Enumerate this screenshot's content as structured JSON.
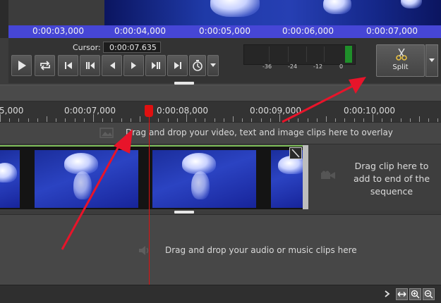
{
  "preview": {
    "ruler_ticks": [
      "0:00:03,000",
      "0:00:04,000",
      "0:00:05,000",
      "0:00:06,000",
      "0:00:07,000"
    ]
  },
  "transport": {
    "cursor_label": "Cursor:",
    "cursor_value": "0:00:07.635",
    "buttons": [
      "play",
      "loop",
      "go-to-start",
      "previous-frame-group",
      "previous-frame",
      "next-frame",
      "next-frame-group",
      "go-to-end",
      "speed"
    ]
  },
  "meter": {
    "labels": [
      "-36",
      "-24",
      "-12",
      "0"
    ]
  },
  "split": {
    "label": "Split"
  },
  "timeline": {
    "ruler_labels": [
      "5,000",
      "0:00:07,000",
      "0:00:08,000",
      "0:00:09,000",
      "0:00:10,000"
    ],
    "overlay_hint": "Drag and drop your video, text and image clips here to overlay",
    "add_end_hint": "Drag clip here to add to end of the sequence",
    "audio_hint": "Drag and drop your audio or music clips here",
    "playhead_color": "#e01010",
    "clip_border_color": "#7fbf5a",
    "arrow_color": "#e8142a"
  }
}
